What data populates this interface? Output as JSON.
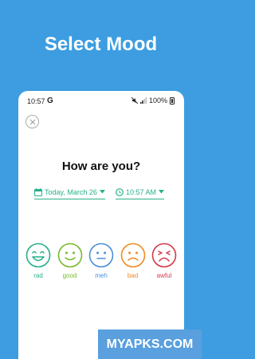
{
  "headline": "Select Mood",
  "statusbar": {
    "time": "10:57",
    "google_letter": "G",
    "battery": "100%"
  },
  "question": "How are you?",
  "date_picker": {
    "label": "Today, March 26"
  },
  "time_picker": {
    "label": "10:57 AM"
  },
  "moods": [
    {
      "label": "rad",
      "color": "#27b08a"
    },
    {
      "label": "good",
      "color": "#7ab92e"
    },
    {
      "label": "meh",
      "color": "#4a90d9"
    },
    {
      "label": "bad",
      "color": "#f08a24"
    },
    {
      "label": "awful",
      "color": "#d63a4a"
    }
  ],
  "accent_color": "#27b08a",
  "watermark": "MYAPKS.COM"
}
